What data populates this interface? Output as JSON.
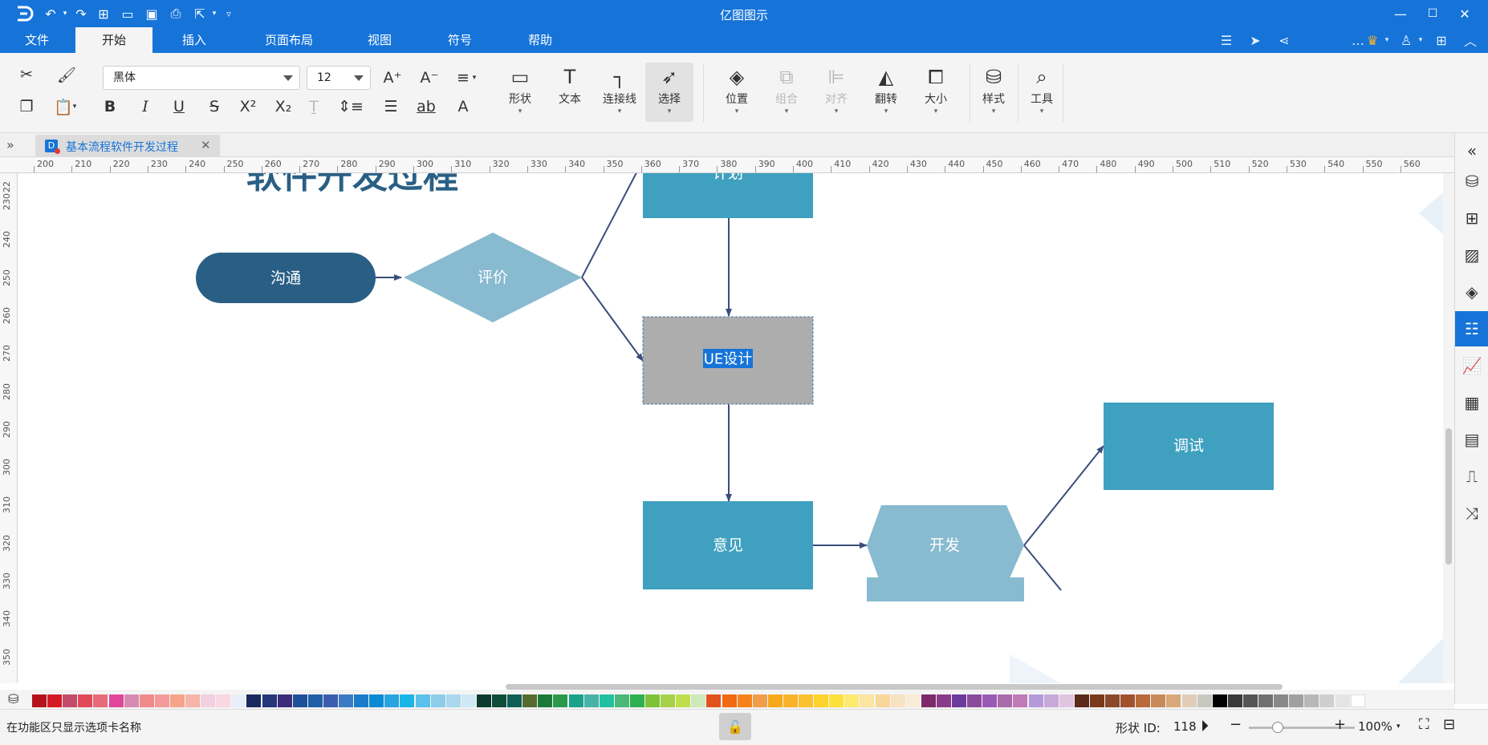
{
  "app": {
    "title": "亿图图示",
    "accent": "#1674d9"
  },
  "menu_tabs": [
    {
      "label": "文件"
    },
    {
      "label": "开始"
    },
    {
      "label": "插入"
    },
    {
      "label": "页面布局"
    },
    {
      "label": "视图"
    },
    {
      "label": "符号"
    },
    {
      "label": "帮助"
    }
  ],
  "ribbon": {
    "font_family": "黑体",
    "font_size": "12",
    "buttons": [
      {
        "label": "形状",
        "icon": "rectangle-icon"
      },
      {
        "label": "文本",
        "icon": "text-icon"
      },
      {
        "label": "连接线",
        "icon": "connector-icon"
      },
      {
        "label": "选择",
        "icon": "cursor-icon"
      },
      {
        "label": "位置",
        "icon": "layers-icon"
      },
      {
        "label": "组合",
        "icon": "group-icon"
      },
      {
        "label": "对齐",
        "icon": "align-icon"
      },
      {
        "label": "翻转",
        "icon": "flip-icon"
      },
      {
        "label": "大小",
        "icon": "size-icon"
      },
      {
        "label": "样式",
        "icon": "paint-bucket-icon"
      },
      {
        "label": "工具",
        "icon": "tools-icon"
      }
    ]
  },
  "document_tab": {
    "name": "基本流程软件开发过程"
  },
  "ruler": {
    "h_labels": [
      "200",
      "210",
      "220",
      "230",
      "240",
      "250",
      "260",
      "270",
      "280",
      "290",
      "300",
      "310",
      "320",
      "330",
      "340",
      "350",
      "360",
      "370",
      "380",
      "390",
      "400",
      "410",
      "420",
      "430",
      "440",
      "450",
      "460",
      "470",
      "480",
      "490",
      "500",
      "510",
      "520",
      "530",
      "540",
      "550",
      "560"
    ],
    "v_labels": [
      "22",
      "230",
      "240",
      "250",
      "260",
      "270",
      "280",
      "290",
      "300",
      "310",
      "320",
      "330",
      "340",
      "350"
    ]
  },
  "diagram": {
    "title": "软件开发过程",
    "nodes": [
      {
        "id": "goutong",
        "label": "沟通",
        "shape": "terminator",
        "color": "#2a5f85"
      },
      {
        "id": "pingjia",
        "label": "评价",
        "shape": "diamond",
        "color": "#88bad0"
      },
      {
        "id": "jihua",
        "label": "计划",
        "shape": "rect",
        "color": "#3fa0bf"
      },
      {
        "id": "uesheji",
        "label": "UE设计",
        "shape": "rect",
        "color": "#adadad",
        "selected": true
      },
      {
        "id": "yijian",
        "label": "意见",
        "shape": "rect",
        "color": "#3fa0bf"
      },
      {
        "id": "kaifa",
        "label": "开发",
        "shape": "hexagon",
        "color": "#88bad0"
      },
      {
        "id": "tiaoshi",
        "label": "调试",
        "shape": "rect",
        "color": "#3fa0bf"
      }
    ]
  },
  "palette": [
    "#b5121b",
    "#d41a26",
    "#c44b6b",
    "#e04a59",
    "#e86a7a",
    "#e0479a",
    "#d78bb1",
    "#f08a8a",
    "#f49a9a",
    "#f5a48a",
    "#f7b4a8",
    "#f3d0e0",
    "#f9d7e3",
    "#e8eef7",
    "#1a2a5e",
    "#23377a",
    "#3b2d7a",
    "#1e4f9a",
    "#1e5fa8",
    "#3b5db0",
    "#3c7ac4",
    "#1a7cc8",
    "#0b8ad4",
    "#2aa4e0",
    "#1cb5e8",
    "#59c1ea",
    "#8dcdea",
    "#a9d7ee",
    "#cfe8f4",
    "#0a3b2e",
    "#0f4d3a",
    "#0f5e55",
    "#556b2f",
    "#1b7a3a",
    "#2a9a4a",
    "#18a38a",
    "#47b3a8",
    "#20c0a0",
    "#4ab879",
    "#2fb050",
    "#7fc238",
    "#a6d148",
    "#bede4e",
    "#cfe8b9",
    "#e2521d",
    "#f06a14",
    "#f5821a",
    "#f29d4a",
    "#f7a81b",
    "#f9b32a",
    "#fbc12e",
    "#fcd22c",
    "#fde03a",
    "#fde96e",
    "#fbe5a0",
    "#f9d69a",
    "#f7e2c2",
    "#f8ecd8",
    "#7b2a6b",
    "#8a3a8a",
    "#6b3a9a",
    "#8a4a9a",
    "#9b59b6",
    "#a86aa8",
    "#c07ab6",
    "#b49ad8",
    "#c7a8d8",
    "#e0c4e0",
    "#5a2a1a",
    "#7a3a1a",
    "#8a4a2a",
    "#a0522d",
    "#b86a3a",
    "#c88a5a",
    "#d8a878",
    "#e0cdb8",
    "#c8c8c0",
    "#000000",
    "#3a3a3a",
    "#555555",
    "#707070",
    "#888888",
    "#a0a0a0",
    "#b8b8b8",
    "#cfcfcf",
    "#e4e4e4",
    "#ffffff"
  ],
  "status": {
    "hint": "在功能区只显示选项卡名称",
    "shape_id_label": "形状 ID:",
    "shape_id": "118",
    "zoom": "100%",
    "zoom_fraction": 0.35
  }
}
